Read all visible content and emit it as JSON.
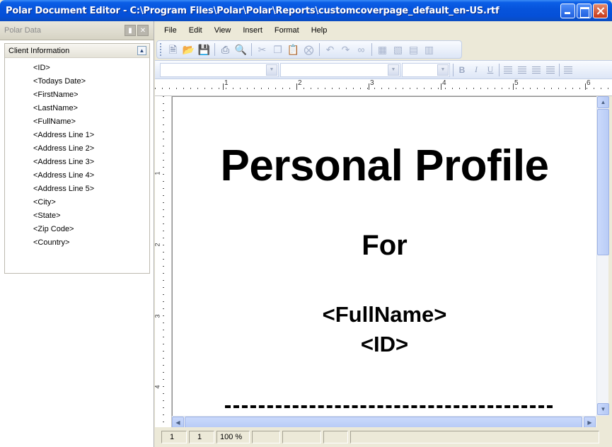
{
  "window": {
    "title": "Polar Document Editor - C:\\Program Files\\Polar\\Polar\\Reports\\customcoverpage_default_en-US.rtf"
  },
  "side_panel": {
    "title": "Polar Data",
    "group": {
      "label": "Client Information",
      "fields": [
        "<ID>",
        "<Todays Date>",
        "<FirstName>",
        "<LastName>",
        "<FullName>",
        "<Address Line 1>",
        "<Address Line 2>",
        "<Address Line 3>",
        "<Address Line 4>",
        "<Address Line 5>",
        "<City>",
        "<State>",
        "<Zip Code>",
        "<Country>"
      ]
    }
  },
  "menu": [
    "File",
    "Edit",
    "View",
    "Insert",
    "Format",
    "Help"
  ],
  "formatting": {
    "bold": "B",
    "italic": "I",
    "underline": "U"
  },
  "ruler": {
    "horizontal_numbers": [
      "1",
      "2",
      "3",
      "4",
      "5",
      "6"
    ],
    "vertical_numbers": [
      "1",
      "2",
      "3",
      "4"
    ]
  },
  "document": {
    "title": "Personal Profile",
    "for_label": "For",
    "full_name_field": "<FullName>",
    "id_field": "<ID>"
  },
  "status": {
    "page": "1",
    "pages": "1",
    "zoom": "100 %"
  },
  "colors": {
    "titlebar": "#0653db",
    "chrome": "#ece9d8",
    "toolbar": "#dde6f6"
  }
}
